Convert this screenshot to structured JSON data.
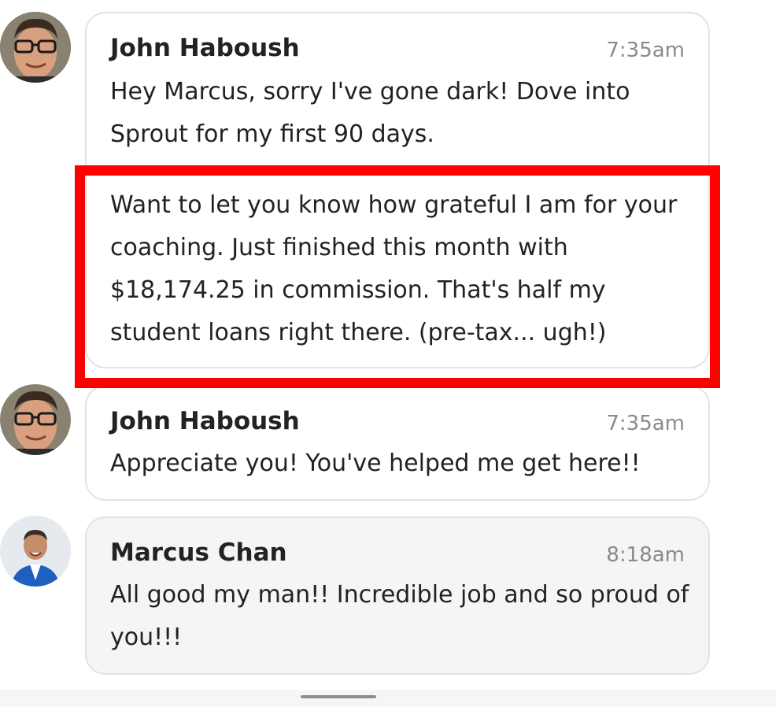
{
  "messages": [
    {
      "sender": "John Haboush",
      "time": "7:35am",
      "paragraph1": "Hey Marcus, sorry I've gone dark! Dove into Sprout for my first 90 days.",
      "paragraph2": "Want to let you know how grateful I am for your coaching. Just finished this month with $18,174.25 in commission. That's half my student loans right there. (pre-tax... ugh!)"
    },
    {
      "sender": "John Haboush",
      "time": "7:35am",
      "text": "Appreciate you! You've helped me get here!!"
    },
    {
      "sender": "Marcus Chan",
      "time": "8:18am",
      "text": "All good my man!! Incredible job and so proud of you!!!"
    }
  ],
  "colors": {
    "highlight": "#ff0000",
    "bubble_border": "#e3e3e3",
    "own_bubble_bg": "#f5f5f5",
    "timestamp": "#8a8a8a"
  }
}
